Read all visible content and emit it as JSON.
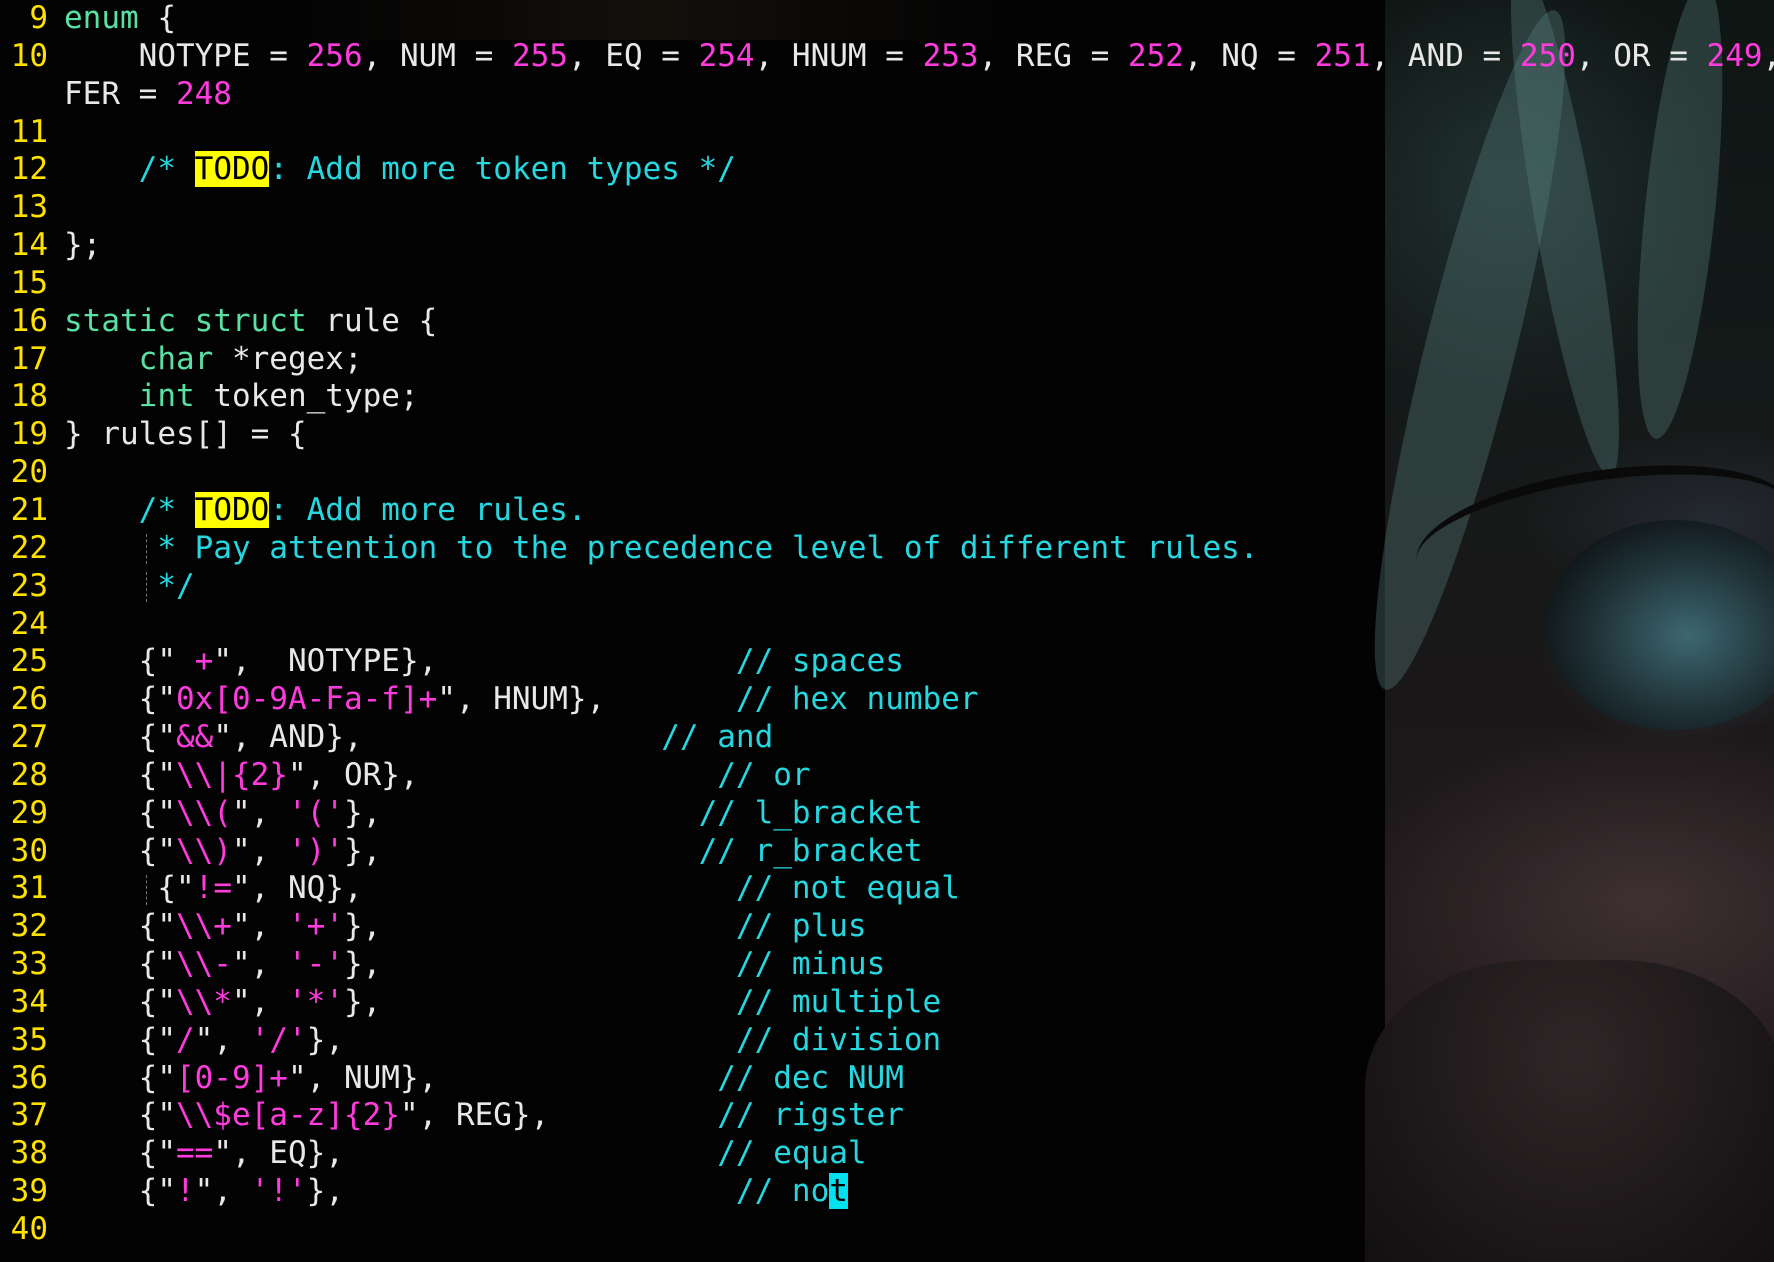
{
  "editor": {
    "colors": {
      "background": "#030303",
      "line_number": "#ffe100",
      "keyword": "#59e0a2",
      "number_string": "#ff3bdd",
      "comment": "#26d7e0",
      "todo_highlight": "#ffff00",
      "cursor": "#00e1f0",
      "text": "#e8e8e8"
    },
    "lines": [
      {
        "n": "9",
        "seg": [
          {
            "k": "kw",
            "t": "enum"
          },
          {
            "k": "p",
            "t": " {"
          }
        ]
      },
      {
        "n": "10",
        "seg": [
          {
            "k": "p",
            "t": "    NOTYPE = "
          },
          {
            "k": "num",
            "t": "256"
          },
          {
            "k": "p",
            "t": ", NUM = "
          },
          {
            "k": "num",
            "t": "255"
          },
          {
            "k": "p",
            "t": ", EQ = "
          },
          {
            "k": "num",
            "t": "254"
          },
          {
            "k": "p",
            "t": ", HNUM = "
          },
          {
            "k": "num",
            "t": "253"
          },
          {
            "k": "p",
            "t": ", REG = "
          },
          {
            "k": "num",
            "t": "252"
          },
          {
            "k": "p",
            "t": ", NQ = "
          },
          {
            "k": "num",
            "t": "251"
          },
          {
            "k": "p",
            "t": ", AND = "
          },
          {
            "k": "num",
            "t": "250"
          },
          {
            "k": "p",
            "t": ", OR = "
          },
          {
            "k": "num",
            "t": "249"
          },
          {
            "k": "p",
            "t": ", DE"
          }
        ]
      },
      {
        "n": "",
        "seg": [
          {
            "k": "p",
            "t": "FER = "
          },
          {
            "k": "num",
            "t": "248"
          }
        ]
      },
      {
        "n": "11",
        "seg": []
      },
      {
        "n": "12",
        "seg": [
          {
            "k": "cm",
            "t": "    /* "
          },
          {
            "k": "todo",
            "t": "TODO"
          },
          {
            "k": "cm",
            "t": ": Add more token types */"
          }
        ]
      },
      {
        "n": "13",
        "seg": []
      },
      {
        "n": "14",
        "seg": [
          {
            "k": "p",
            "t": "};"
          }
        ]
      },
      {
        "n": "15",
        "seg": []
      },
      {
        "n": "16",
        "seg": [
          {
            "k": "kw",
            "t": "static"
          },
          {
            "k": "p",
            "t": " "
          },
          {
            "k": "kw",
            "t": "struct"
          },
          {
            "k": "p",
            "t": " rule {"
          }
        ]
      },
      {
        "n": "17",
        "seg": [
          {
            "k": "p",
            "t": "    "
          },
          {
            "k": "kw",
            "t": "char"
          },
          {
            "k": "p",
            "t": " *regex;"
          }
        ]
      },
      {
        "n": "18",
        "seg": [
          {
            "k": "p",
            "t": "    "
          },
          {
            "k": "kw",
            "t": "int"
          },
          {
            "k": "p",
            "t": " token_type;"
          }
        ]
      },
      {
        "n": "19",
        "seg": [
          {
            "k": "p",
            "t": "} rules[] = {"
          }
        ]
      },
      {
        "n": "20",
        "seg": []
      },
      {
        "n": "21",
        "seg": [
          {
            "k": "cm",
            "t": "    /* "
          },
          {
            "k": "todo",
            "t": "TODO"
          },
          {
            "k": "cm",
            "t": ": Add more rules."
          }
        ]
      },
      {
        "n": "22",
        "seg": [
          {
            "k": "cm",
            "t": "     * Pay attention to the precedence level of different rules."
          }
        ]
      },
      {
        "n": "23",
        "seg": [
          {
            "k": "cm",
            "t": "     */"
          }
        ]
      },
      {
        "n": "24",
        "seg": []
      },
      {
        "n": "25",
        "seg": [
          {
            "k": "p",
            "t": "    {\""
          },
          {
            "k": "str",
            "t": " +"
          },
          {
            "k": "p",
            "t": "\",  NOTYPE},                "
          },
          {
            "k": "cm",
            "t": "// spaces"
          }
        ]
      },
      {
        "n": "26",
        "seg": [
          {
            "k": "p",
            "t": "    {\""
          },
          {
            "k": "str",
            "t": "0x[0-9A-Fa-f]+"
          },
          {
            "k": "p",
            "t": "\", HNUM},       "
          },
          {
            "k": "cm",
            "t": "// hex number"
          }
        ]
      },
      {
        "n": "27",
        "seg": [
          {
            "k": "p",
            "t": "    {\""
          },
          {
            "k": "str",
            "t": "&&"
          },
          {
            "k": "p",
            "t": "\", AND},                "
          },
          {
            "k": "cm",
            "t": "// and"
          }
        ]
      },
      {
        "n": "28",
        "seg": [
          {
            "k": "p",
            "t": "    {\""
          },
          {
            "k": "str",
            "t": "\\\\|{2}"
          },
          {
            "k": "p",
            "t": "\", OR},                "
          },
          {
            "k": "cm",
            "t": "// or"
          }
        ]
      },
      {
        "n": "29",
        "seg": [
          {
            "k": "p",
            "t": "    {\""
          },
          {
            "k": "str",
            "t": "\\\\("
          },
          {
            "k": "p",
            "t": "\", "
          },
          {
            "k": "str",
            "t": "'('"
          },
          {
            "k": "p",
            "t": "},                 "
          },
          {
            "k": "cm",
            "t": "// l_bracket"
          }
        ]
      },
      {
        "n": "30",
        "seg": [
          {
            "k": "p",
            "t": "    {\""
          },
          {
            "k": "str",
            "t": "\\\\)"
          },
          {
            "k": "p",
            "t": "\", "
          },
          {
            "k": "str",
            "t": "')'"
          },
          {
            "k": "p",
            "t": "},                 "
          },
          {
            "k": "cm",
            "t": "// r_bracket"
          }
        ]
      },
      {
        "n": "31",
        "seg": [
          {
            "k": "p",
            "t": "     {\""
          },
          {
            "k": "str",
            "t": "!="
          },
          {
            "k": "p",
            "t": "\", NQ},                    "
          },
          {
            "k": "cm",
            "t": "// not equal"
          }
        ]
      },
      {
        "n": "32",
        "seg": [
          {
            "k": "p",
            "t": "    {\""
          },
          {
            "k": "str",
            "t": "\\\\+"
          },
          {
            "k": "p",
            "t": "\", "
          },
          {
            "k": "str",
            "t": "'+'"
          },
          {
            "k": "p",
            "t": "},                   "
          },
          {
            "k": "cm",
            "t": "// plus"
          }
        ]
      },
      {
        "n": "33",
        "seg": [
          {
            "k": "p",
            "t": "    {\""
          },
          {
            "k": "str",
            "t": "\\\\-"
          },
          {
            "k": "p",
            "t": "\", "
          },
          {
            "k": "str",
            "t": "'-'"
          },
          {
            "k": "p",
            "t": "},                   "
          },
          {
            "k": "cm",
            "t": "// minus"
          }
        ]
      },
      {
        "n": "34",
        "seg": [
          {
            "k": "p",
            "t": "    {\""
          },
          {
            "k": "str",
            "t": "\\\\*"
          },
          {
            "k": "p",
            "t": "\", "
          },
          {
            "k": "str",
            "t": "'*'"
          },
          {
            "k": "p",
            "t": "},                   "
          },
          {
            "k": "cm",
            "t": "// multiple"
          }
        ]
      },
      {
        "n": "35",
        "seg": [
          {
            "k": "p",
            "t": "    {\""
          },
          {
            "k": "str",
            "t": "/"
          },
          {
            "k": "p",
            "t": "\", "
          },
          {
            "k": "str",
            "t": "'/'"
          },
          {
            "k": "p",
            "t": "},                     "
          },
          {
            "k": "cm",
            "t": "// division"
          }
        ]
      },
      {
        "n": "36",
        "seg": [
          {
            "k": "p",
            "t": "    {\""
          },
          {
            "k": "str",
            "t": "[0-9]+"
          },
          {
            "k": "p",
            "t": "\", NUM},               "
          },
          {
            "k": "cm",
            "t": "// dec NUM"
          }
        ]
      },
      {
        "n": "37",
        "seg": [
          {
            "k": "p",
            "t": "    {\""
          },
          {
            "k": "str",
            "t": "\\\\$e[a-z]{2}"
          },
          {
            "k": "p",
            "t": "\", REG},         "
          },
          {
            "k": "cm",
            "t": "// rigster"
          }
        ]
      },
      {
        "n": "38",
        "seg": [
          {
            "k": "p",
            "t": "    {\""
          },
          {
            "k": "str",
            "t": "=="
          },
          {
            "k": "p",
            "t": "\", EQ},                    "
          },
          {
            "k": "cm",
            "t": "// equal"
          }
        ]
      },
      {
        "n": "39",
        "seg": [
          {
            "k": "p",
            "t": "    {\""
          },
          {
            "k": "str",
            "t": "!"
          },
          {
            "k": "p",
            "t": "\", "
          },
          {
            "k": "str",
            "t": "'!'"
          },
          {
            "k": "p",
            "t": "},                     "
          },
          {
            "k": "cm",
            "t": "// no"
          },
          {
            "k": "cursor",
            "t": "t"
          }
        ]
      },
      {
        "n": "40",
        "seg": []
      }
    ]
  }
}
